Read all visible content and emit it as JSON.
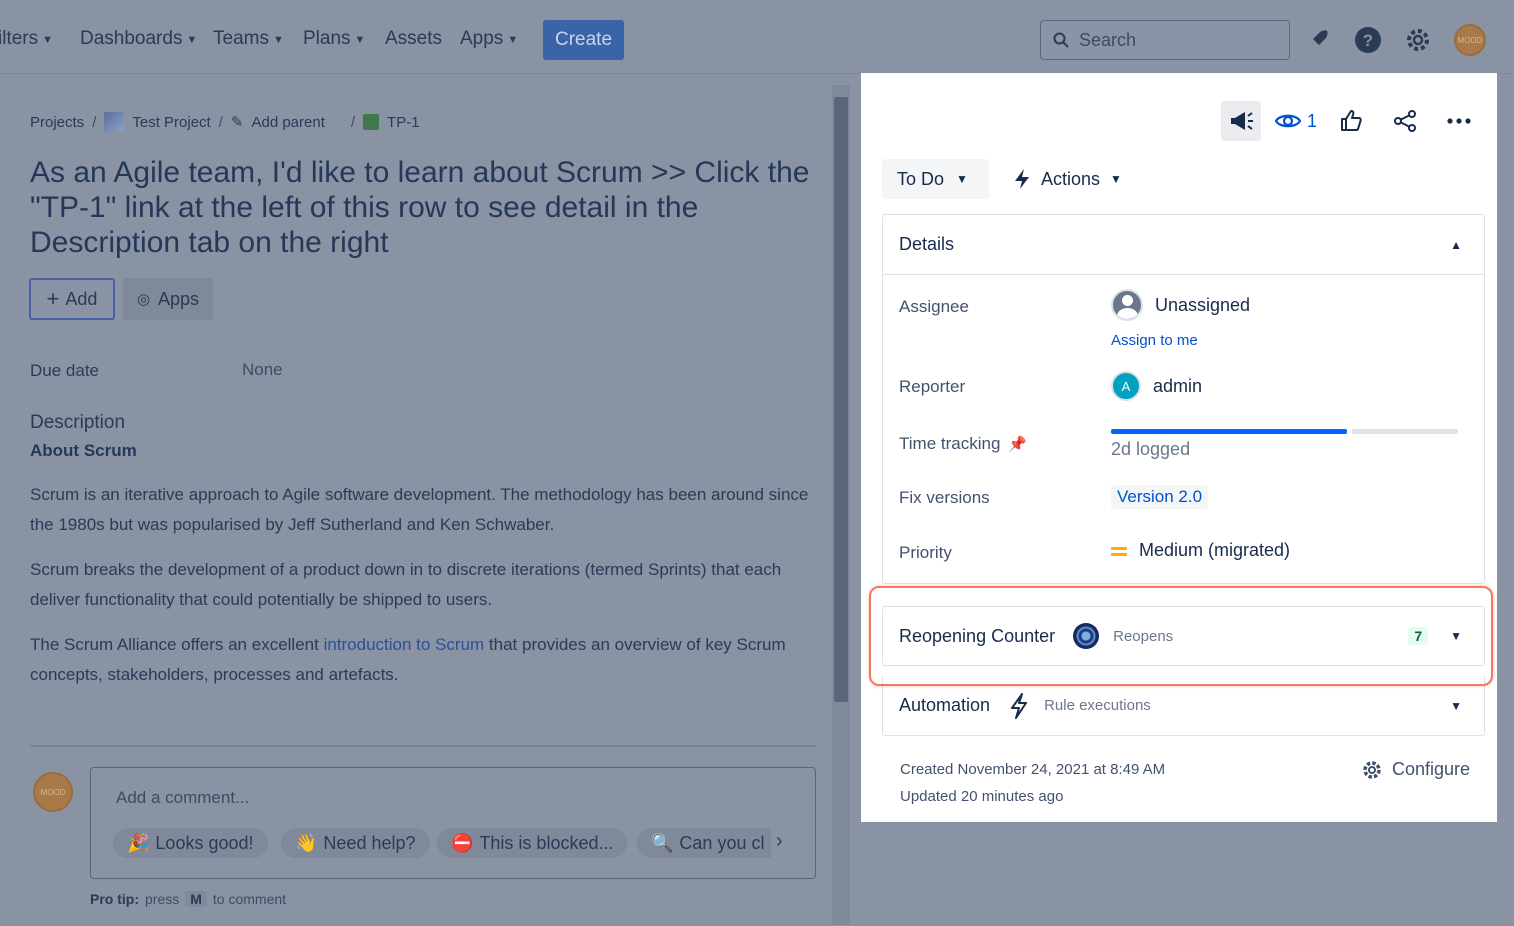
{
  "topnav": {
    "items": [
      {
        "label": "ilters",
        "has_chevron": true
      },
      {
        "label": "Dashboards",
        "has_chevron": true
      },
      {
        "label": "Teams",
        "has_chevron": true
      },
      {
        "label": "Plans",
        "has_chevron": true
      },
      {
        "label": "Assets",
        "has_chevron": false
      },
      {
        "label": "Apps",
        "has_chevron": true
      }
    ],
    "create_label": "Create",
    "search_placeholder": "Search",
    "avatar_text": "MOOD"
  },
  "issue": {
    "breadcrumb": {
      "projects": "Projects",
      "project": "Test Project",
      "add_parent": "Add parent",
      "key": "TP-1"
    },
    "title": "As an Agile team, I'd like to learn about Scrum >> Click the \"TP-1\" link at the left of this row to see detail in the Description tab on the right",
    "add_label": "Add",
    "apps_label": "Apps",
    "due_date_label": "Due date",
    "due_date_value": "None",
    "description_heading": "Description",
    "description_subheading": "About Scrum",
    "para1": "Scrum is an iterative approach to Agile software development. The methodology has been around since the 1980s but was popularised by Jeff Sutherland and Ken Schwaber.",
    "para2": "Scrum breaks the development of a product down in to discrete iterations (termed Sprints) that each deliver functionality that could potentially be shipped to users.",
    "para3_before": "The Scrum Alliance offers an excellent ",
    "para3_link": "introduction to Scrum",
    "para3_after": " that provides an overview of key Scrum concepts, stakeholders, processes and artefacts."
  },
  "comment": {
    "avatar_text": "MOOD",
    "placeholder": "Add a comment...",
    "chips": [
      "Looks good!",
      "Need help?",
      "This is blocked...",
      "Can you cl"
    ],
    "pro_tip_label": "Pro tip:",
    "pro_tip_press": "press",
    "pro_tip_key": "M",
    "pro_tip_rest": "to comment"
  },
  "sidebar": {
    "watch_count": "1",
    "status_label": "To Do",
    "actions_label": "Actions",
    "details_title": "Details",
    "fields": {
      "assignee_label": "Assignee",
      "assignee_value": "Unassigned",
      "assign_to_me": "Assign to me",
      "reporter_label": "Reporter",
      "reporter_initial": "A",
      "reporter_value": "admin",
      "time_tracking_label": "Time tracking",
      "time_tracking_fraction": 0.68,
      "time_logged": "2d logged",
      "fix_versions_label": "Fix versions",
      "fix_version_value": "Version 2.0",
      "priority_label": "Priority",
      "priority_value": "Medium (migrated)"
    },
    "reopening": {
      "title": "Reopening Counter",
      "subtitle": "Reopens",
      "count": "7"
    },
    "automation": {
      "title": "Automation",
      "subtitle": "Rule executions"
    },
    "created": "Created November 24, 2021 at 8:49 AM",
    "updated": "Updated 20 minutes ago",
    "configure_label": "Configure"
  },
  "colors": {
    "overlay": "#8993a4",
    "accent": "#0052cc",
    "highlight_ring": "#f27a5c",
    "priority_medium": "#ffab00"
  }
}
